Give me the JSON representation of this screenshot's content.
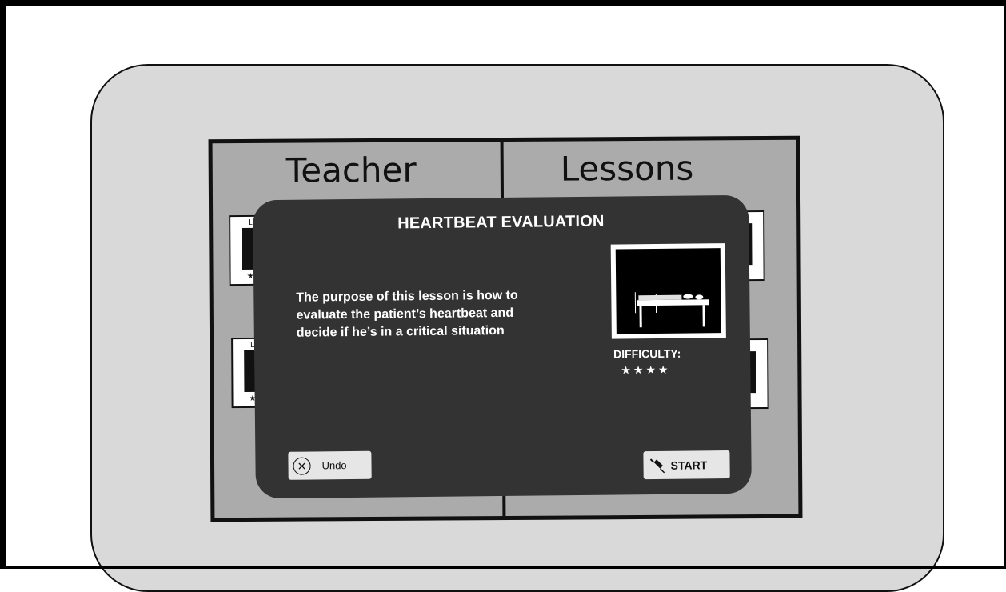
{
  "panel": {
    "left_title": "Teacher",
    "right_title": "Lessons",
    "card_star": "★",
    "card_label": "L"
  },
  "modal": {
    "title": "HEARTBEAT EVALUATION",
    "description": "The purpose of this lesson is how to evaluate the patient’s heartbeat and decide if he’s in a critical situation",
    "thumbnail_icon": "hospital-bed-icon",
    "difficulty_label": "DIFFICULTY:",
    "difficulty_stars": "★★★★",
    "difficulty_rating": 4
  },
  "buttons": {
    "undo_label": "Undo",
    "undo_icon": "close-circle-icon",
    "start_label": "START",
    "start_icon": "syringe-icon"
  },
  "colors": {
    "modal_bg": "#333333",
    "panel_bg": "#ababab",
    "device_bg": "#d9d9d9",
    "button_bg": "#e6e6e6"
  }
}
